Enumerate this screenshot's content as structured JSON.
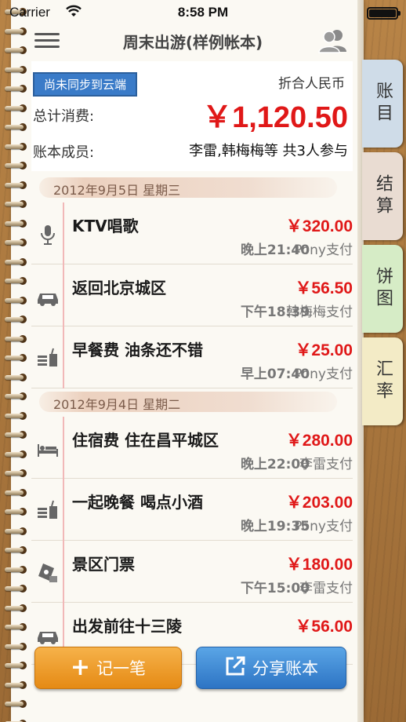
{
  "status_bar": {
    "carrier": "Carrier",
    "time": "8:58 PM"
  },
  "header": {
    "title": "周末出游(样例帐本)"
  },
  "summary": {
    "sync_badge": "尚未同步到云端",
    "currency_note": "折合人民币",
    "total_label": "总计消费:",
    "total_value": "￥1,120.50",
    "members_label": "账本成员:",
    "members_value": "李雷,韩梅梅等 共3人参与"
  },
  "groups": [
    {
      "date": "2012年9月5日 星期三",
      "items": [
        {
          "icon": "microphone-icon",
          "name": "KTV唱歌",
          "time": "晚上21:40",
          "amount": "￥320.00",
          "payer": "Pony支付"
        },
        {
          "icon": "car-icon",
          "name": "返回北京城区",
          "time": "下午18:39",
          "amount": "￥56.50",
          "payer": "韩梅梅支付"
        },
        {
          "icon": "meal-icon",
          "name": "早餐费 油条还不错",
          "time": "早上07:40",
          "amount": "￥25.00",
          "payer": "Pony支付"
        }
      ]
    },
    {
      "date": "2012年9月4日 星期二",
      "items": [
        {
          "icon": "bed-icon",
          "name": "住宿费 住在昌平城区",
          "time": "晚上22:00",
          "amount": "￥280.00",
          "payer": "李雷支付"
        },
        {
          "icon": "meal-icon",
          "name": "一起晚餐 喝点小酒",
          "time": "晚上19:35",
          "amount": "￥203.00",
          "payer": "Pony支付"
        },
        {
          "icon": "ticket-icon",
          "name": "景区门票",
          "time": "下午15:00",
          "amount": "￥180.00",
          "payer": "李雷支付"
        },
        {
          "icon": "car-icon",
          "name": "出发前往十三陵",
          "time": "",
          "amount": "￥56.00",
          "payer": ""
        }
      ]
    }
  ],
  "tabs": {
    "ledger": "账目",
    "settle": "结算",
    "pie": "饼图",
    "rate": "汇率"
  },
  "buttons": {
    "add": "记一笔",
    "share": "分享账本"
  },
  "colors": {
    "amount": "#e01818",
    "sync_badge": "#3a7bc8",
    "add_button": "#e58a14",
    "share_button": "#2d74c4"
  }
}
